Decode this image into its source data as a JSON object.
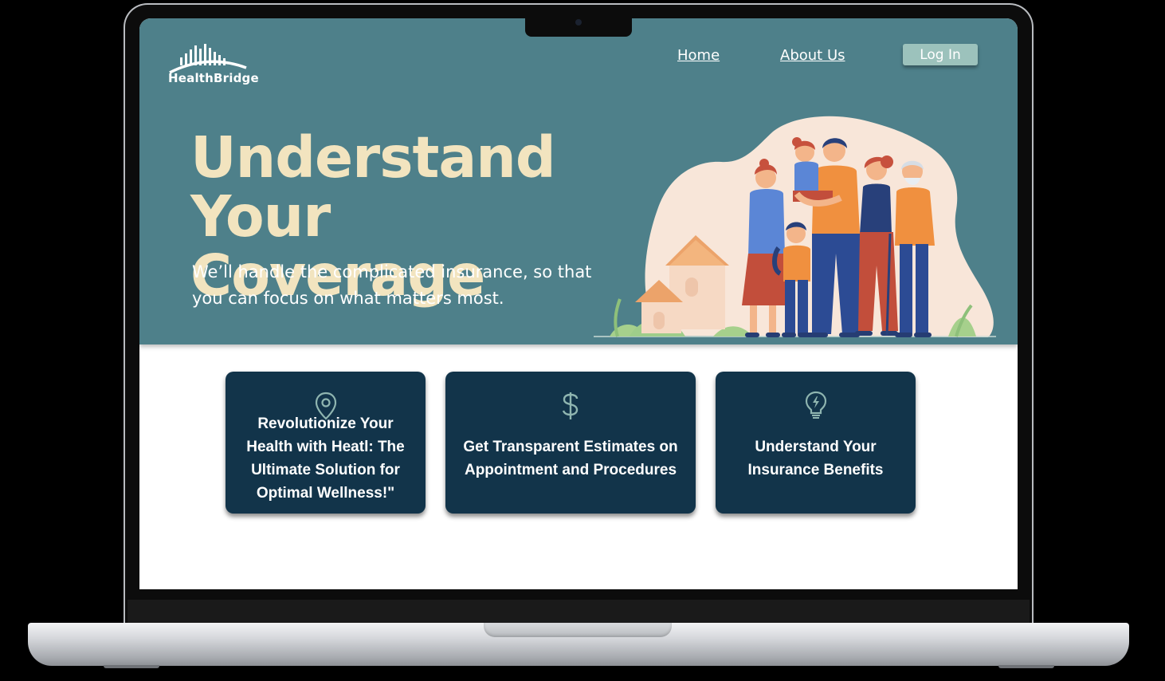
{
  "brand": {
    "name": "HealthBridge"
  },
  "nav": {
    "links": [
      {
        "label": "Home"
      },
      {
        "label": "About Us"
      }
    ],
    "login_label": "Log In"
  },
  "hero": {
    "headline_line1": "Understand",
    "headline_line2": "Your Coverage",
    "subtext": "We’ll handle the complicated insurance, so that you can focus on what matters most."
  },
  "cards": [
    {
      "icon": "location-pin-icon",
      "title": "Revolutionize Your Health with Heatl: The Ultimate Solution for Optimal Wellness!\""
    },
    {
      "icon": "dollar-sign-icon",
      "title": "Get Transparent Estimates on Appointment and Procedures"
    },
    {
      "icon": "lightbulb-icon",
      "title": "Understand Your Insurance Benefits"
    }
  ],
  "colors": {
    "hero_bg": "#4e808a",
    "headline": "#f2e4bf",
    "card_bg": "#12344a",
    "login_bg": "#9cc2bc",
    "icon_accent": "#8fb5b0"
  }
}
